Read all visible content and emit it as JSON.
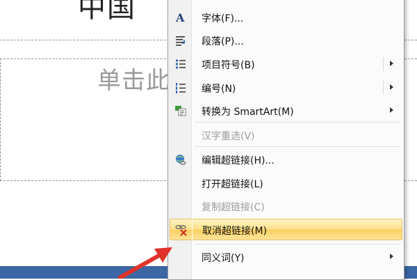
{
  "slide": {
    "title_fragment": "中国",
    "placeholder_text": "单击此"
  },
  "context_menu": {
    "items": [
      {
        "label": "字体(F)...",
        "icon": "font-icon",
        "submenu": false,
        "disabled": false
      },
      {
        "label": "段落(P)...",
        "icon": "paragraph-icon",
        "submenu": false,
        "disabled": false
      },
      {
        "label": "项目符号(B)",
        "icon": "bullets-icon",
        "submenu": true,
        "disabled": false
      },
      {
        "label": "编号(N)",
        "icon": "numbering-icon",
        "submenu": true,
        "disabled": false
      },
      {
        "label": "转换为 SmartArt(M)",
        "icon": "smartart-icon",
        "submenu": true,
        "disabled": false
      },
      {
        "label": "汉字重选(V)",
        "icon": "",
        "submenu": false,
        "disabled": true
      },
      {
        "label": "编辑超链接(H)...",
        "icon": "hyperlink-icon",
        "submenu": false,
        "disabled": false
      },
      {
        "label": "打开超链接(L)",
        "icon": "",
        "submenu": false,
        "disabled": false
      },
      {
        "label": "复制超链接(C)",
        "icon": "",
        "submenu": false,
        "disabled": true
      },
      {
        "label": "取消超链接(M)",
        "icon": "remove-hyperlink-icon",
        "submenu": false,
        "disabled": false,
        "highlighted": true
      },
      {
        "label": "同义词(Y)",
        "icon": "",
        "submenu": true,
        "disabled": false
      }
    ]
  },
  "colors": {
    "highlight": "#fde18a",
    "bottom_bar": "#3c67a4",
    "pointer_arrow": "#e0322b"
  }
}
